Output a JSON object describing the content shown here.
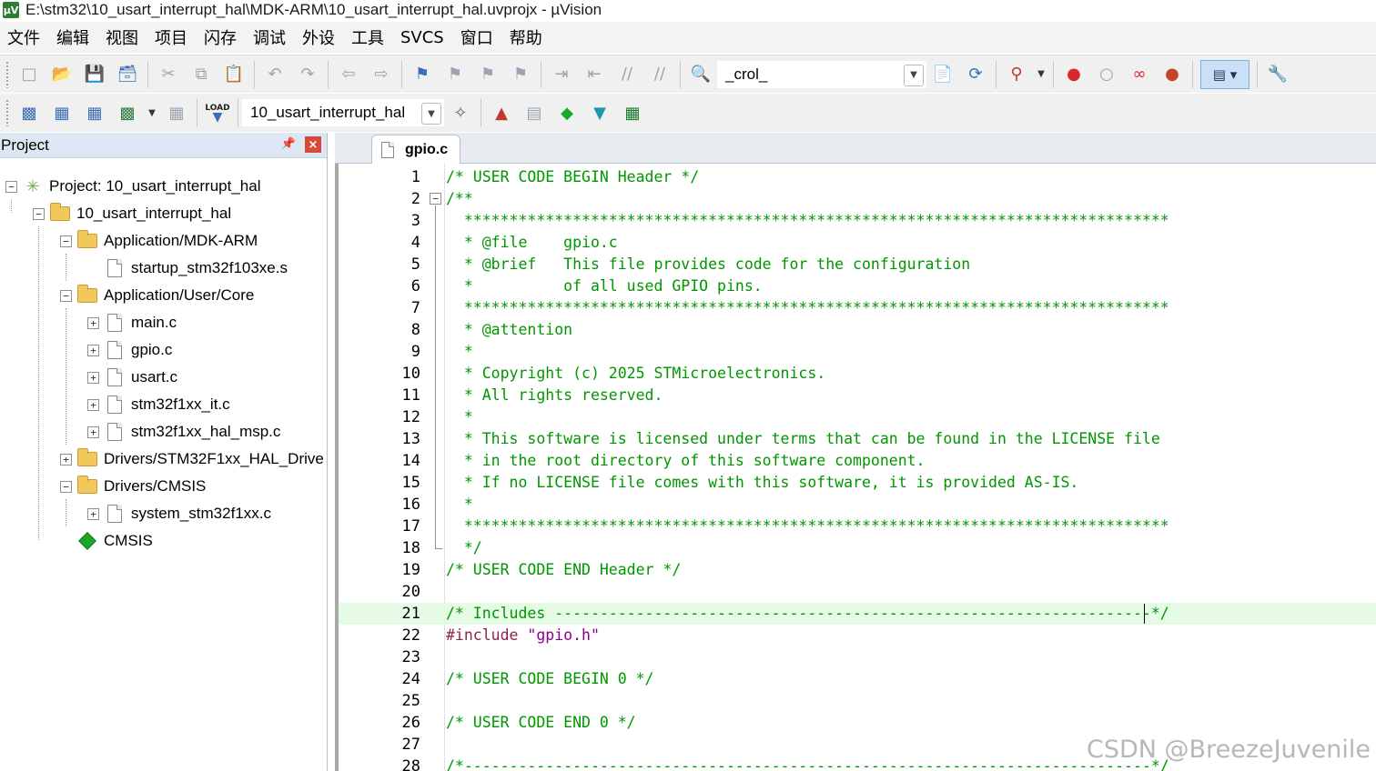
{
  "window": {
    "title": "E:\\stm32\\10_usart_interrupt_hal\\MDK-ARM\\10_usart_interrupt_hal.uvprojx - µVision",
    "app_icon": "uv-icon"
  },
  "menu": [
    "文件",
    "编辑",
    "视图",
    "项目",
    "闪存",
    "调试",
    "外设",
    "工具",
    "SVCS",
    "窗口",
    "帮助"
  ],
  "toolbar1": {
    "function_combo": "_crol_",
    "icons": [
      "new-file-icon",
      "open-icon",
      "save-icon",
      "save-all-icon",
      "cut-icon",
      "copy-icon",
      "paste-icon",
      "undo-icon",
      "redo-icon",
      "nav-back-icon",
      "nav-forward-icon",
      "bookmark-icon",
      "prev-bookmark-icon",
      "next-bookmark-icon",
      "clear-bookmarks-icon",
      "indent-icon",
      "unindent-icon",
      "comment-icon",
      "uncomment-icon",
      "find-in-files-icon",
      "find-icon",
      "incremental-find-icon",
      "debug-icon",
      "breakpoint-icon",
      "disable-breakpoint-icon",
      "disable-all-breakpoints-icon",
      "kill-all-breakpoints-icon",
      "window-layout-icon",
      "configure-icon"
    ]
  },
  "toolbar2": {
    "target_combo": "10_usart_interrupt_hal",
    "load_label": "LOAD",
    "icons": [
      "translate-icon",
      "build-icon",
      "rebuild-icon",
      "batch-build-icon",
      "stop-build-icon",
      "download-icon",
      "target-options-icon",
      "manage-components-icon",
      "file-extensions-icon",
      "manage-rte-icon",
      "select-packs-icon",
      "pack-installer-icon"
    ]
  },
  "project_panel": {
    "title": "Project",
    "nodes": [
      {
        "label": "Project: 10_usart_interrupt_hal",
        "depth": 0,
        "expander": "minus",
        "icon": "project-icon"
      },
      {
        "label": "10_usart_interrupt_hal",
        "depth": 1,
        "expander": "minus",
        "icon": "target-folder-icon"
      },
      {
        "label": "Application/MDK-ARM",
        "depth": 2,
        "expander": "minus",
        "icon": "folder-icon"
      },
      {
        "label": "startup_stm32f103xe.s",
        "depth": 3,
        "expander": "none",
        "icon": "file-icon"
      },
      {
        "label": "Application/User/Core",
        "depth": 2,
        "expander": "minus",
        "icon": "folder-icon"
      },
      {
        "label": "main.c",
        "depth": 3,
        "expander": "plus",
        "icon": "file-icon"
      },
      {
        "label": "gpio.c",
        "depth": 3,
        "expander": "plus",
        "icon": "file-icon"
      },
      {
        "label": "usart.c",
        "depth": 3,
        "expander": "plus",
        "icon": "file-icon"
      },
      {
        "label": "stm32f1xx_it.c",
        "depth": 3,
        "expander": "plus",
        "icon": "file-icon"
      },
      {
        "label": "stm32f1xx_hal_msp.c",
        "depth": 3,
        "expander": "plus",
        "icon": "file-icon"
      },
      {
        "label": "Drivers/STM32F1xx_HAL_Drive",
        "depth": 2,
        "expander": "plus",
        "icon": "folder-icon"
      },
      {
        "label": "Drivers/CMSIS",
        "depth": 2,
        "expander": "minus",
        "icon": "folder-icon"
      },
      {
        "label": "system_stm32f1xx.c",
        "depth": 3,
        "expander": "plus",
        "icon": "file-icon"
      },
      {
        "label": "CMSIS",
        "depth": 2,
        "expander": "none",
        "icon": "rte-component-icon"
      }
    ]
  },
  "editor": {
    "active_tab": "gpio.c",
    "current_line": 21,
    "lines": [
      {
        "n": "1",
        "text": "/* USER CODE BEGIN Header */",
        "kind": "comment"
      },
      {
        "n": "2",
        "text": "/**",
        "kind": "comment"
      },
      {
        "n": "3",
        "text": "  ******************************************************************************",
        "kind": "comment"
      },
      {
        "n": "4",
        "text": "  * @file    gpio.c",
        "kind": "comment"
      },
      {
        "n": "5",
        "text": "  * @brief   This file provides code for the configuration",
        "kind": "comment"
      },
      {
        "n": "6",
        "text": "  *          of all used GPIO pins.",
        "kind": "comment"
      },
      {
        "n": "7",
        "text": "  ******************************************************************************",
        "kind": "comment"
      },
      {
        "n": "8",
        "text": "  * @attention",
        "kind": "comment"
      },
      {
        "n": "9",
        "text": "  *",
        "kind": "comment"
      },
      {
        "n": "10",
        "text": "  * Copyright (c) 2025 STMicroelectronics.",
        "kind": "comment"
      },
      {
        "n": "11",
        "text": "  * All rights reserved.",
        "kind": "comment"
      },
      {
        "n": "12",
        "text": "  *",
        "kind": "comment"
      },
      {
        "n": "13",
        "text": "  * This software is licensed under terms that can be found in the LICENSE file",
        "kind": "comment"
      },
      {
        "n": "14",
        "text": "  * in the root directory of this software component.",
        "kind": "comment"
      },
      {
        "n": "15",
        "text": "  * If no LICENSE file comes with this software, it is provided AS-IS.",
        "kind": "comment"
      },
      {
        "n": "16",
        "text": "  *",
        "kind": "comment"
      },
      {
        "n": "17",
        "text": "  ******************************************************************************",
        "kind": "comment"
      },
      {
        "n": "18",
        "text": "  */",
        "kind": "comment"
      },
      {
        "n": "19",
        "text": "/* USER CODE END Header */",
        "kind": "comment"
      },
      {
        "n": "20",
        "text": "",
        "kind": "comment"
      },
      {
        "n": "21",
        "text": "/* Includes ------------------------------------------------------------------*/",
        "kind": "comment"
      },
      {
        "n": "22",
        "text": "#include ",
        "kind": "pp",
        "string": "\"gpio.h\""
      },
      {
        "n": "23",
        "text": "",
        "kind": "comment"
      },
      {
        "n": "24",
        "text": "/* USER CODE BEGIN 0 */",
        "kind": "comment"
      },
      {
        "n": "25",
        "text": "",
        "kind": "comment"
      },
      {
        "n": "26",
        "text": "/* USER CODE END 0 */",
        "kind": "comment"
      },
      {
        "n": "27",
        "text": "",
        "kind": "comment"
      },
      {
        "n": "28",
        "text": "/*----------------------------------------------------------------------------*/",
        "kind": "comment"
      }
    ]
  },
  "watermark": "CSDN @BreezeJuvenile",
  "colors": {
    "comment": "#009600",
    "preprocessor": "#8b2252",
    "string": "#8b008b",
    "current_line_bg": "#e6fbe6",
    "panel_header": "#dde6f3"
  }
}
